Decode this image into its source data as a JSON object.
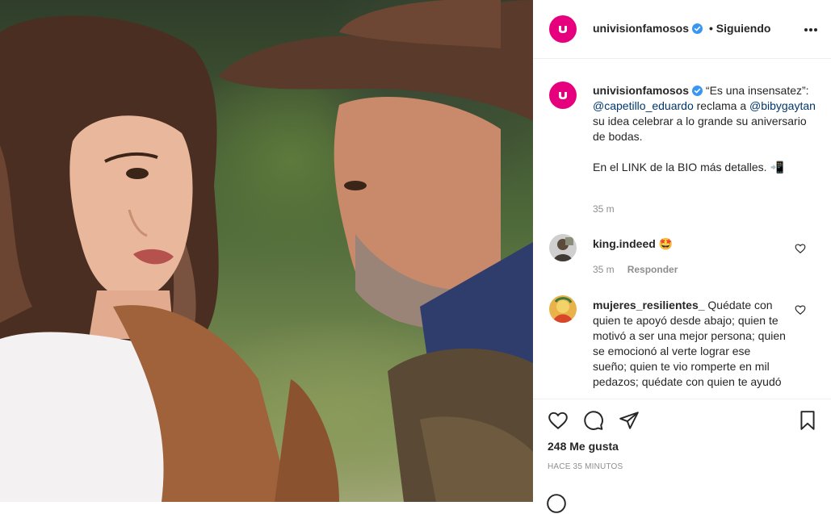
{
  "post": {
    "username": "univisionfamosos",
    "follow_status": "• Siguiendo"
  },
  "caption": {
    "username": "univisionfamosos",
    "text_part1": " “Es una insensatez”: ",
    "mention1": "@capetillo_eduardo",
    "text_part2": " reclama a ",
    "mention2": "@bibygaytan",
    "text_part3": " su idea celebrar a lo grande su aniversario de bodas.",
    "text_part4": "En el LINK de la BIO más detalles. 📲",
    "time": "35 m"
  },
  "comments": [
    {
      "username": "king.indeed",
      "text": " 🤩",
      "time": "35 m",
      "reply_label": "Responder"
    },
    {
      "username": "mujeres_resilientes_",
      "text": " Quédate con quien te apoyó desde abajo; quien te motivó a ser una mejor persona; quien se emocionó al verte lograr ese sueño; quien te vio romperte en mil pedazos; quédate con quien te ayudó",
      "time": "",
      "reply_label": ""
    }
  ],
  "footer": {
    "likes": "248 Me gusta",
    "timestamp": "HACE 35 MINUTOS"
  },
  "icons": {
    "more": "more-options-icon",
    "like": "heart-icon",
    "comment": "comment-icon",
    "share": "paper-plane-icon",
    "save": "bookmark-icon",
    "verified": "verified-badge-icon"
  },
  "colors": {
    "brand": "#e6007e",
    "verified": "#3897f0",
    "mention": "#00376b",
    "muted": "#8e8e8e"
  }
}
